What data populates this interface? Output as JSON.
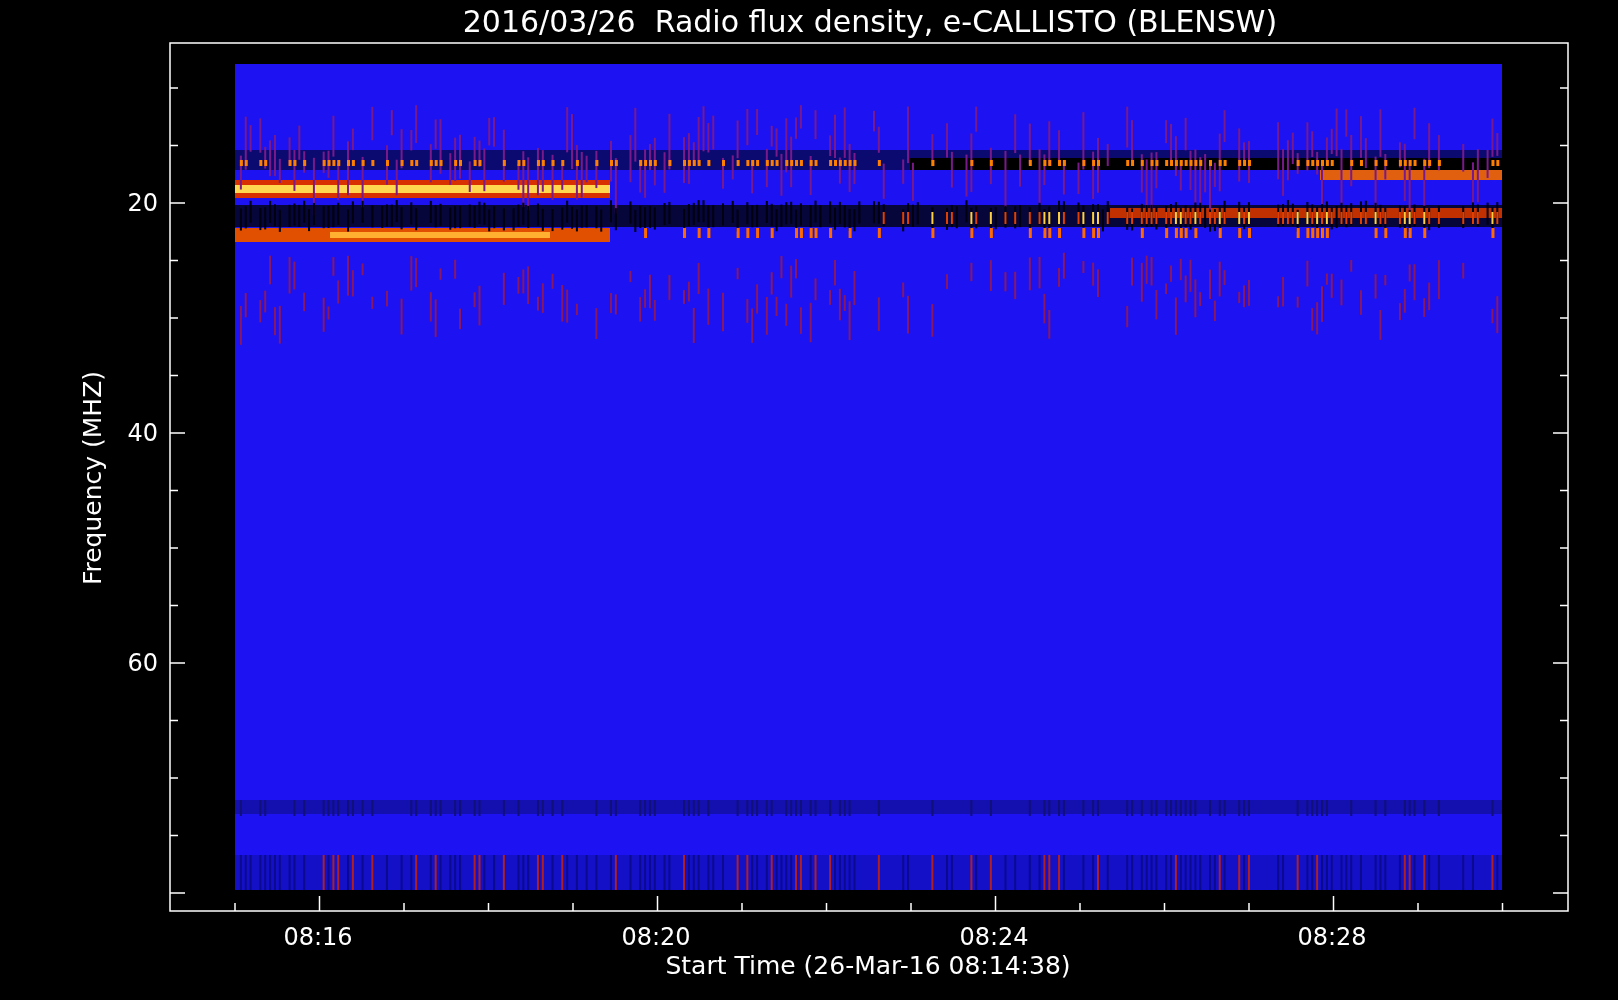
{
  "title": "2016/03/26  Radio flux density, e-CALLISTO (BLENSW)",
  "y_axis": {
    "label": "Frequency (MHZ)",
    "ticks": [
      "20",
      "40",
      "60"
    ]
  },
  "x_axis": {
    "label": "Start Time (26-Mar-16 08:14:38)",
    "ticks": [
      "08:16",
      "08:20",
      "08:24",
      "08:28"
    ]
  }
}
